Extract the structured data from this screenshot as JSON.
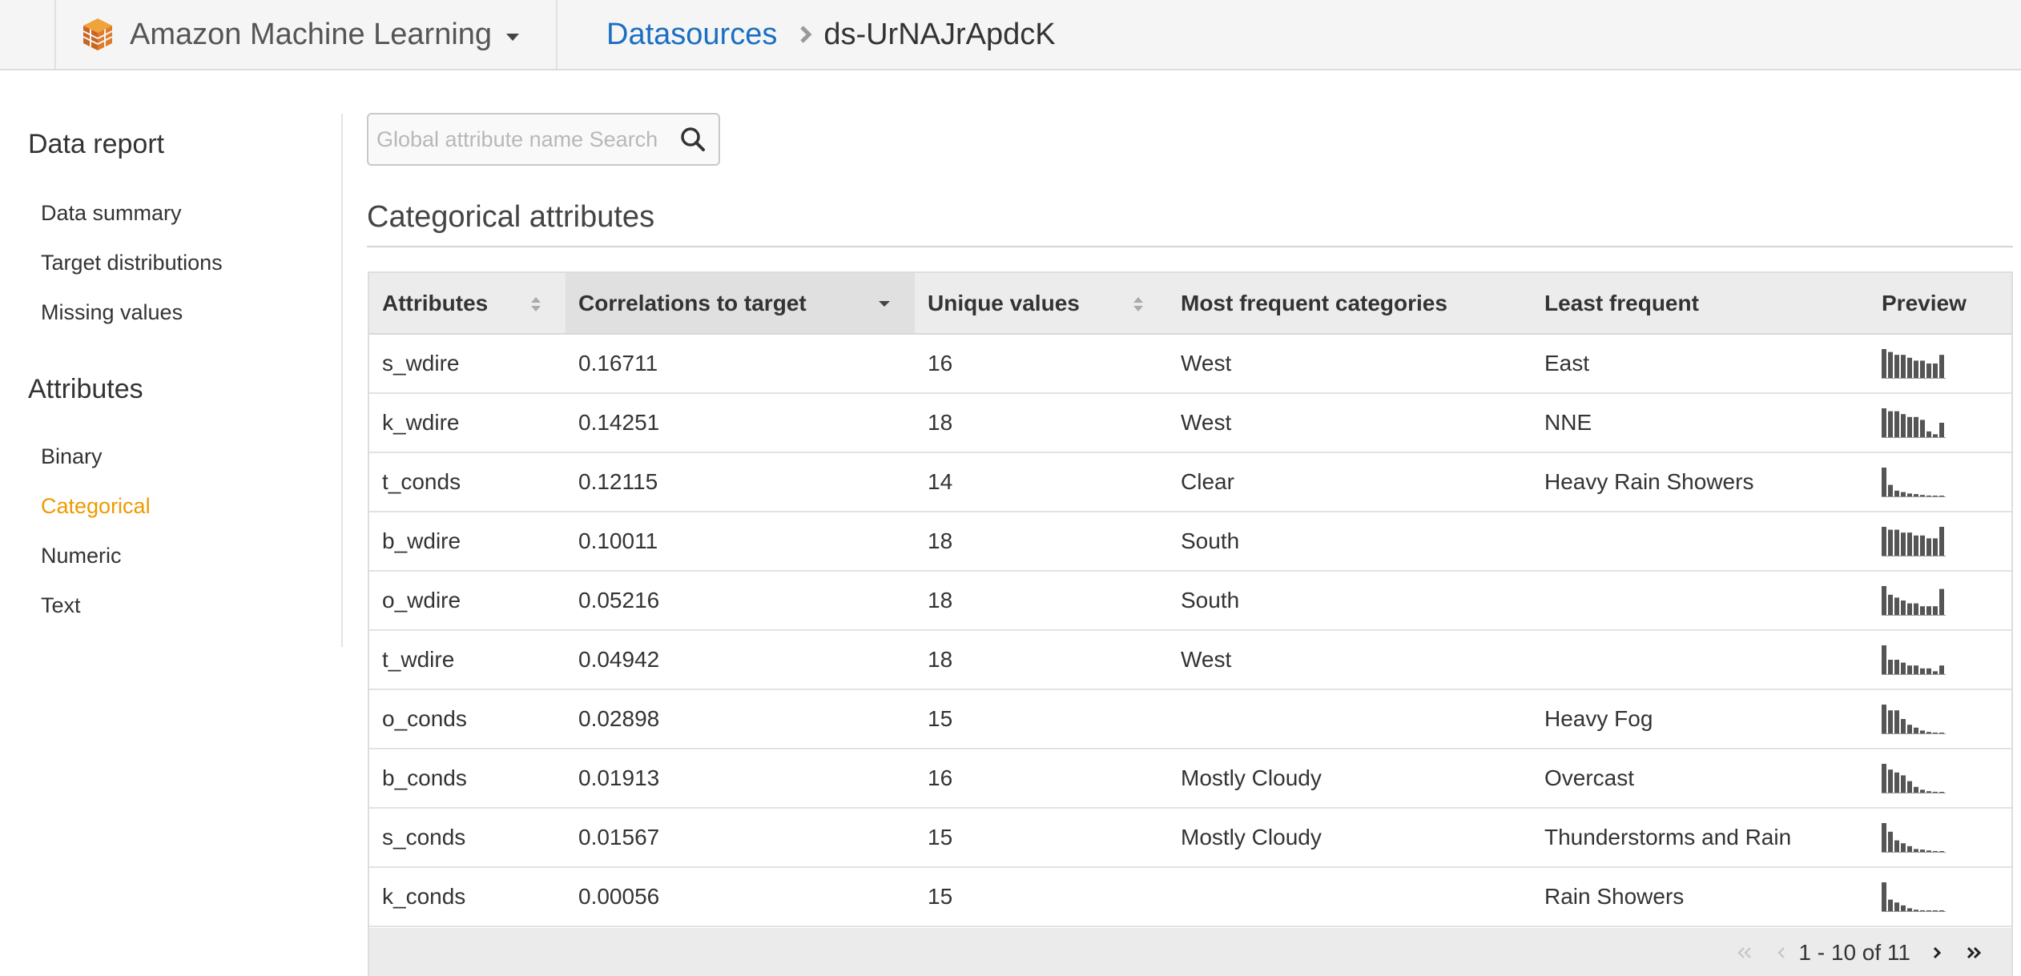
{
  "header": {
    "app_name": "Amazon Machine Learning",
    "logo_icon": "amazon-ml-cube-icon",
    "breadcrumb": {
      "parent": "Datasources",
      "current": "ds-UrNAJrApdcK"
    }
  },
  "sidebar": {
    "report_heading": "Data report",
    "report_items": [
      {
        "label": "Data summary"
      },
      {
        "label": "Target distributions"
      },
      {
        "label": "Missing values"
      }
    ],
    "attributes_heading": "Attributes",
    "attribute_items": [
      {
        "label": "Binary",
        "active": false
      },
      {
        "label": "Categorical",
        "active": true
      },
      {
        "label": "Numeric",
        "active": false
      },
      {
        "label": "Text",
        "active": false
      }
    ],
    "active_color": "#ee9a00"
  },
  "search": {
    "placeholder": "Global attribute name Search",
    "value": ""
  },
  "section_title": "Categorical attributes",
  "table": {
    "columns": [
      {
        "label": "Attributes",
        "sort": "both"
      },
      {
        "label": "Correlations to target",
        "sort": "desc"
      },
      {
        "label": "Unique values",
        "sort": "both"
      },
      {
        "label": "Most frequent categories",
        "sort": ""
      },
      {
        "label": "Least frequent",
        "sort": ""
      },
      {
        "label": "Preview",
        "sort": ""
      }
    ],
    "rows": [
      {
        "attribute": "s_wdire",
        "correlation": "0.16711",
        "unique": "16",
        "most": "West",
        "least": "East",
        "preview": [
          10,
          9,
          8,
          8,
          7,
          6,
          6,
          5,
          5,
          8
        ]
      },
      {
        "attribute": "k_wdire",
        "correlation": "0.14251",
        "unique": "18",
        "most": "West",
        "least": "NNE",
        "preview": [
          10,
          9,
          9,
          8,
          7,
          7,
          6,
          2,
          1,
          5
        ]
      },
      {
        "attribute": "t_conds",
        "correlation": "0.12115",
        "unique": "14",
        "most": "Clear",
        "least": "Heavy Rain Showers",
        "preview": [
          10,
          4,
          2,
          1.5,
          1,
          0.8,
          0.5,
          0.3,
          0.2,
          0.1
        ]
      },
      {
        "attribute": "b_wdire",
        "correlation": "0.10011",
        "unique": "18",
        "most": "South",
        "least": "",
        "preview": [
          10,
          9,
          9,
          8,
          8,
          7,
          7,
          6,
          6,
          10
        ]
      },
      {
        "attribute": "o_wdire",
        "correlation": "0.05216",
        "unique": "18",
        "most": "South",
        "least": "",
        "preview": [
          10,
          7,
          6,
          5,
          4,
          4,
          3,
          3,
          3,
          9
        ]
      },
      {
        "attribute": "t_wdire",
        "correlation": "0.04942",
        "unique": "18",
        "most": "West",
        "least": "",
        "preview": [
          10,
          5,
          5,
          4,
          3,
          3,
          2,
          2,
          1,
          3
        ]
      },
      {
        "attribute": "o_conds",
        "correlation": "0.02898",
        "unique": "15",
        "most": "",
        "least": "Heavy Fog",
        "preview": [
          10,
          8,
          8,
          5,
          3,
          2,
          1,
          0.5,
          0.3,
          0.2
        ]
      },
      {
        "attribute": "b_conds",
        "correlation": "0.01913",
        "unique": "16",
        "most": "Mostly Cloudy",
        "least": "Overcast",
        "preview": [
          10,
          8,
          7,
          6,
          4,
          2,
          1,
          0.5,
          0.3,
          0.2
        ]
      },
      {
        "attribute": "s_conds",
        "correlation": "0.01567",
        "unique": "15",
        "most": "Mostly Cloudy",
        "least": "Thunderstorms and Rain",
        "preview": [
          10,
          7,
          4,
          3,
          2,
          1,
          0.8,
          0.5,
          0.3,
          0.2
        ]
      },
      {
        "attribute": "k_conds",
        "correlation": "0.00056",
        "unique": "15",
        "most": "",
        "least": "Rain Showers",
        "preview": [
          10,
          4,
          3,
          2,
          1,
          0.5,
          0.3,
          0.2,
          0.1,
          0.1
        ]
      }
    ]
  },
  "pagination": {
    "range": "1 - 10 of 11"
  },
  "colors": {
    "link": "#1a6fc2",
    "preview_bar": "#555555"
  }
}
